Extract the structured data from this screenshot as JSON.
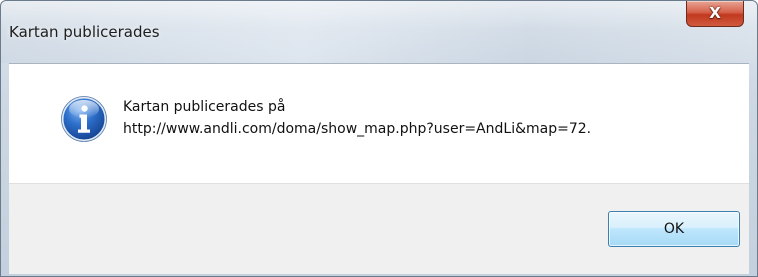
{
  "window": {
    "title": "Kartan publicerades",
    "close_glyph": "X"
  },
  "message": {
    "icon": "info-icon",
    "line1": "Kartan publicerades på",
    "line2": "http://www.andli.com/doma/show_map.php?user=AndLi&map=72."
  },
  "buttons": {
    "ok_label": "OK"
  },
  "colors": {
    "info_icon_blue": "#1f5fb8",
    "close_button_red": "#c2391f",
    "ok_button_border": "#3c7fb1"
  }
}
